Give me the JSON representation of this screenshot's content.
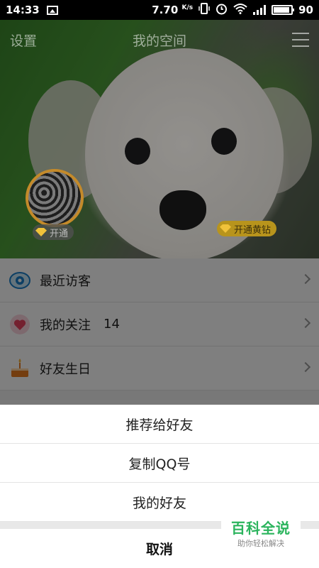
{
  "status_bar": {
    "time": "14:33",
    "speed": "7.70",
    "speed_unit": "K/s",
    "battery": "90"
  },
  "header": {
    "settings_label": "设置",
    "title": "我的空间"
  },
  "cover": {
    "open_badge": "开通",
    "yellow_badge": "开通黄钻"
  },
  "list": {
    "items": [
      {
        "label": "最近访客",
        "icon": "eye-icon"
      },
      {
        "label": "我的关注",
        "count": "14",
        "icon": "heart-icon"
      },
      {
        "label": "好友生日",
        "icon": "cake-icon"
      }
    ]
  },
  "sheet": {
    "options": [
      "推荐给好友",
      "复制QQ号",
      "我的好友"
    ],
    "cancel": "取消"
  },
  "watermark": {
    "title": "百科全说",
    "subtitle": "助你轻松解决"
  },
  "colors": {
    "accent_green": "#2bb45d",
    "badge_gold": "#f0c23a"
  }
}
